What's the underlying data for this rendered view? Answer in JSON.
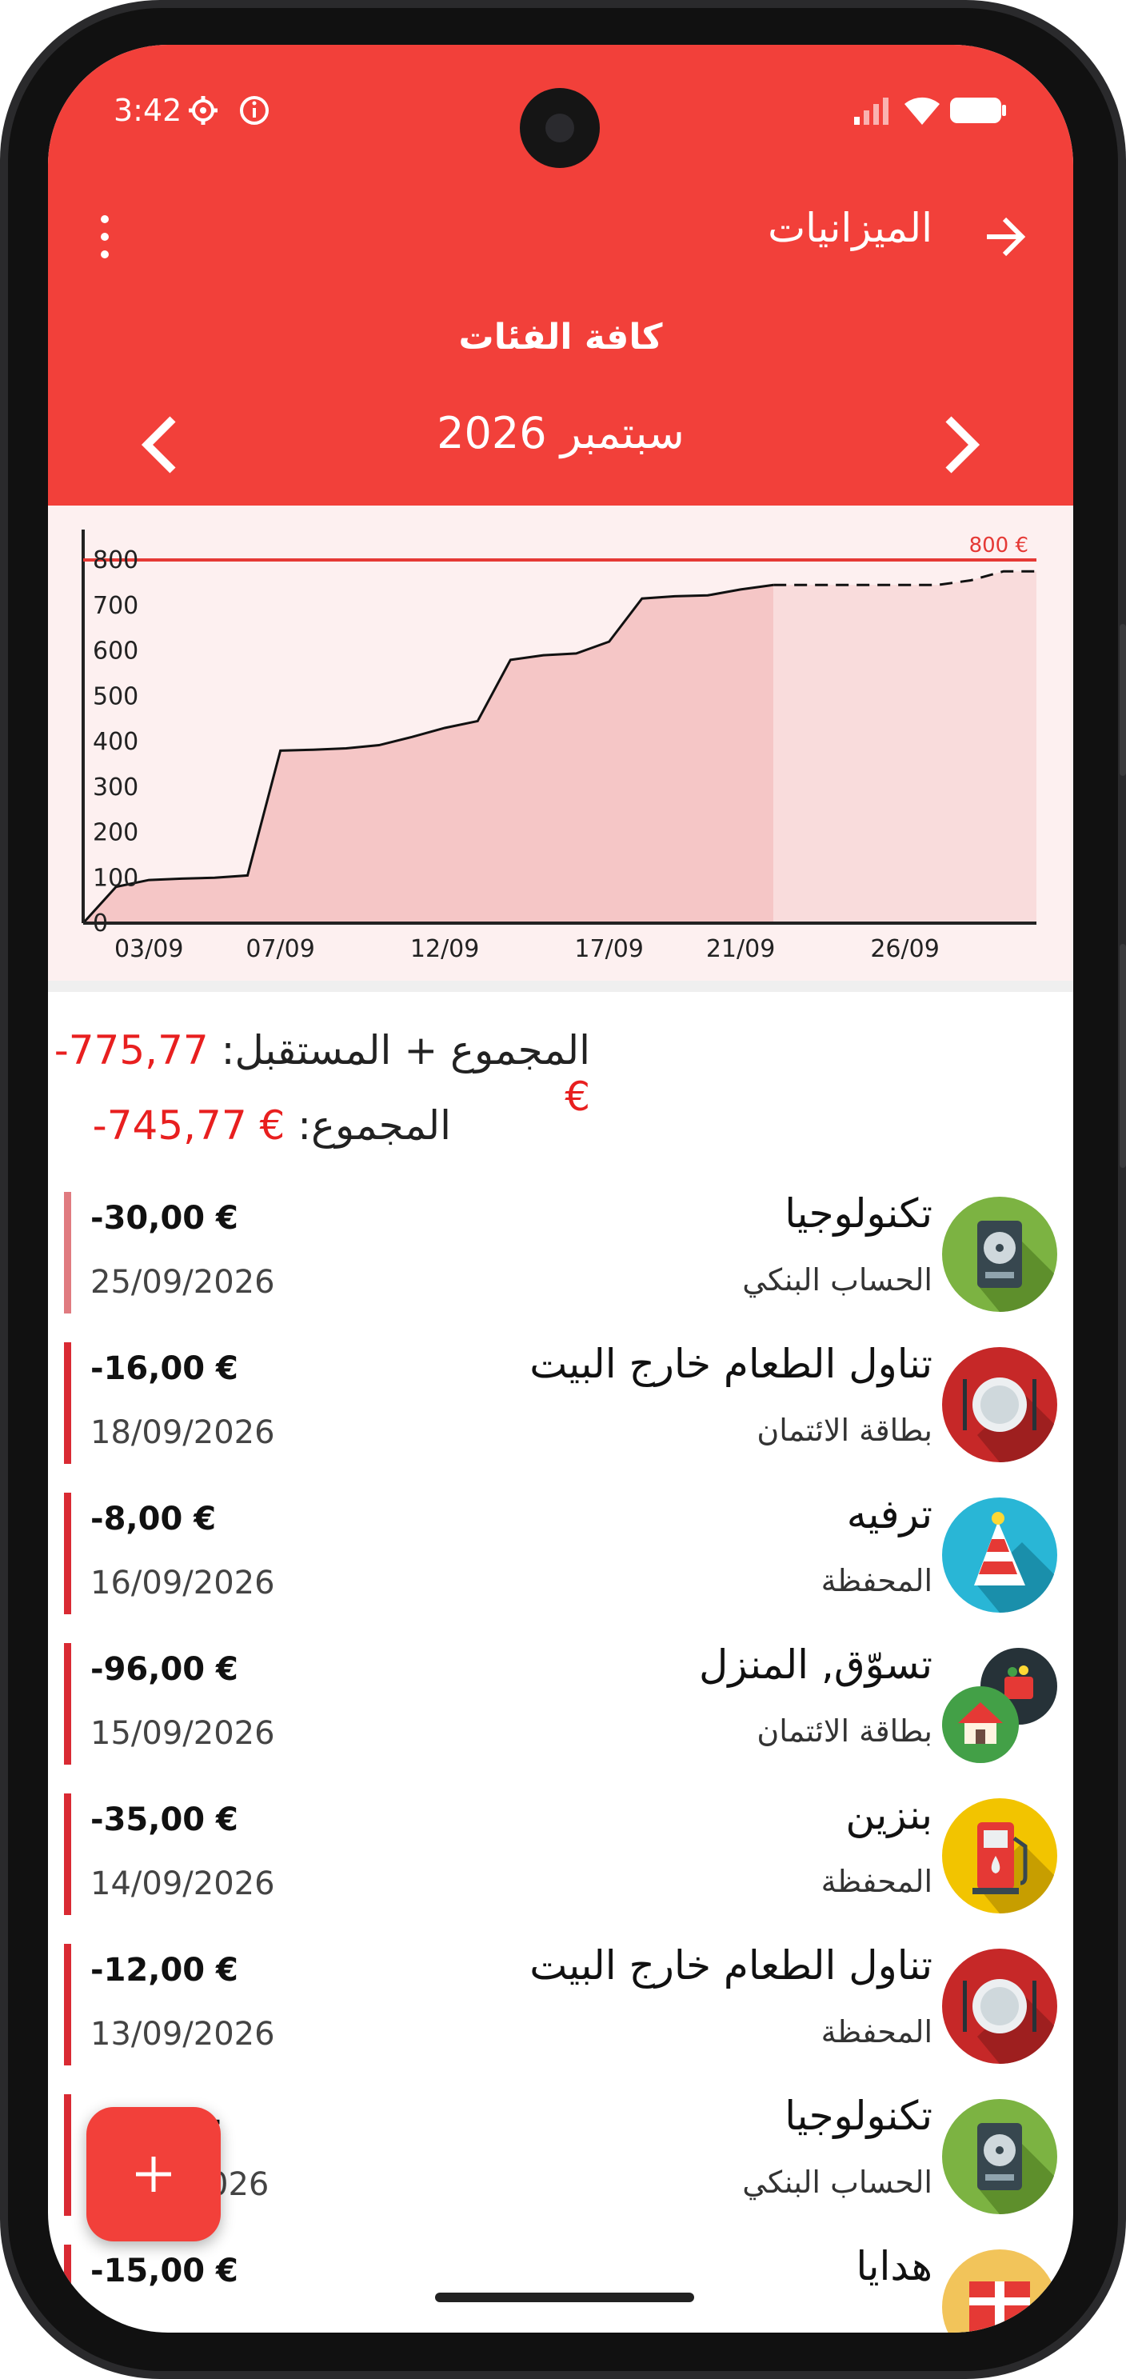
{
  "status_bar": {
    "time": "3:42"
  },
  "toolbar": {
    "title": "الميزانيات"
  },
  "header": {
    "category_filter": "كافة الفئات",
    "month": "سبتمبر 2026"
  },
  "chart_data": {
    "type": "area",
    "x_ticks": [
      "03/09",
      "07/09",
      "12/09",
      "17/09",
      "21/09",
      "26/09"
    ],
    "y_ticks": [
      "0",
      "100",
      "200",
      "300",
      "400",
      "500",
      "600",
      "700",
      "800"
    ],
    "ylim": [
      0,
      800
    ],
    "budget_line": {
      "value": 800,
      "label": "800 €"
    },
    "x": [
      1,
      2,
      3,
      4,
      5,
      6,
      7,
      8,
      9,
      10,
      11,
      12,
      13,
      14,
      15,
      16,
      17,
      18,
      19,
      20,
      21,
      22,
      23,
      24,
      25,
      26,
      27,
      28,
      29,
      30
    ],
    "actual": [
      0,
      80,
      95,
      98,
      100,
      105,
      380,
      382,
      385,
      392,
      410,
      430,
      445,
      580,
      590,
      594,
      620,
      715,
      720,
      722,
      735,
      745,
      null,
      null,
      null,
      null,
      null,
      null,
      null,
      null
    ],
    "projected": [
      null,
      null,
      null,
      null,
      null,
      null,
      null,
      null,
      null,
      null,
      null,
      null,
      null,
      null,
      null,
      null,
      null,
      null,
      null,
      null,
      null,
      745,
      745,
      745,
      745,
      745,
      745,
      755,
      775,
      775
    ]
  },
  "totals": {
    "future_label": "المجموع + المستقبل:",
    "future_amount": "-775,77 €",
    "total_label": "المجموع:",
    "total_amount": "-745,77 €"
  },
  "transactions": [
    {
      "title": "تكنولوجيا",
      "account": "الحساب البنكي",
      "amount": "-30,00 €",
      "date": "25/09/2026",
      "icon": "hard-drive-icon"
    },
    {
      "title": "تناول الطعام خارج البيت",
      "account": "بطاقة الائتمان",
      "amount": "-16,00 €",
      "date": "18/09/2026",
      "icon": "plate-icon"
    },
    {
      "title": "ترفيه",
      "account": "المحفظة",
      "amount": "-8,00 €",
      "date": "16/09/2026",
      "icon": "party-hat-icon"
    },
    {
      "title": "تسوّق, المنزل",
      "account": "بطاقة الائتمان",
      "amount": "-96,00 €",
      "date": "15/09/2026",
      "icon": "shopping-home-icon"
    },
    {
      "title": "بنزين",
      "account": "المحفظة",
      "amount": "-35,00 €",
      "date": "14/09/2026",
      "icon": "fuel-pump-icon"
    },
    {
      "title": "تناول الطعام خارج البيت",
      "account": "المحفظة",
      "amount": "-12,00 €",
      "date": "13/09/2026",
      "icon": "plate-icon"
    },
    {
      "title": "تكنولوجيا",
      "account": "الحساب البنكي",
      "amount": "-",
      "date": "026",
      "icon": "hard-drive-icon"
    },
    {
      "title": "هدايا",
      "account": "",
      "amount": "-15,00 €",
      "date": "",
      "icon": "gift-icon"
    }
  ],
  "colors": {
    "primary": "#f2403a",
    "negative": "#e81f1f",
    "expense_bar": "#d92a33"
  }
}
